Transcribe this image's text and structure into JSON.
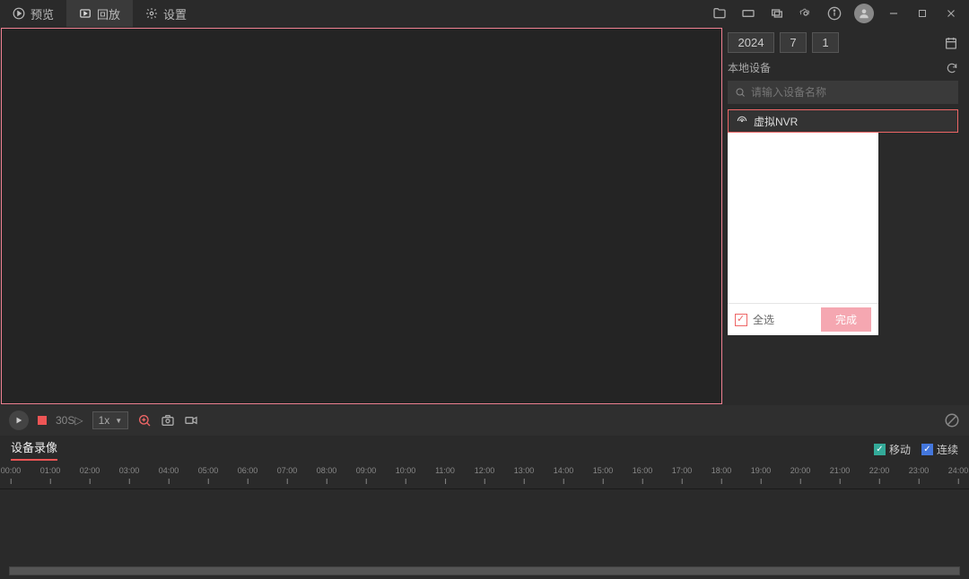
{
  "tabs": {
    "preview": "预览",
    "playback": "回放",
    "settings": "设置"
  },
  "date": {
    "year": "2024",
    "month": "7",
    "day": "1"
  },
  "side": {
    "devices_label": "本地设备",
    "search_placeholder": "请输入设备名称",
    "device_name": "虚拟NVR",
    "select_all": "全选",
    "done": "完成"
  },
  "controls": {
    "skip": "30S▷",
    "speed": "1x"
  },
  "bottom": {
    "recording_tab": "设备录像",
    "legend_motion": "移动",
    "legend_continuous": "连续"
  },
  "timeline": {
    "hours": [
      "00:00",
      "01:00",
      "02:00",
      "03:00",
      "04:00",
      "05:00",
      "06:00",
      "07:00",
      "08:00",
      "09:00",
      "10:00",
      "11:00",
      "12:00",
      "13:00",
      "14:00",
      "15:00",
      "16:00",
      "17:00",
      "18:00",
      "19:00",
      "20:00",
      "21:00",
      "22:00",
      "23:00",
      "24:00"
    ]
  }
}
